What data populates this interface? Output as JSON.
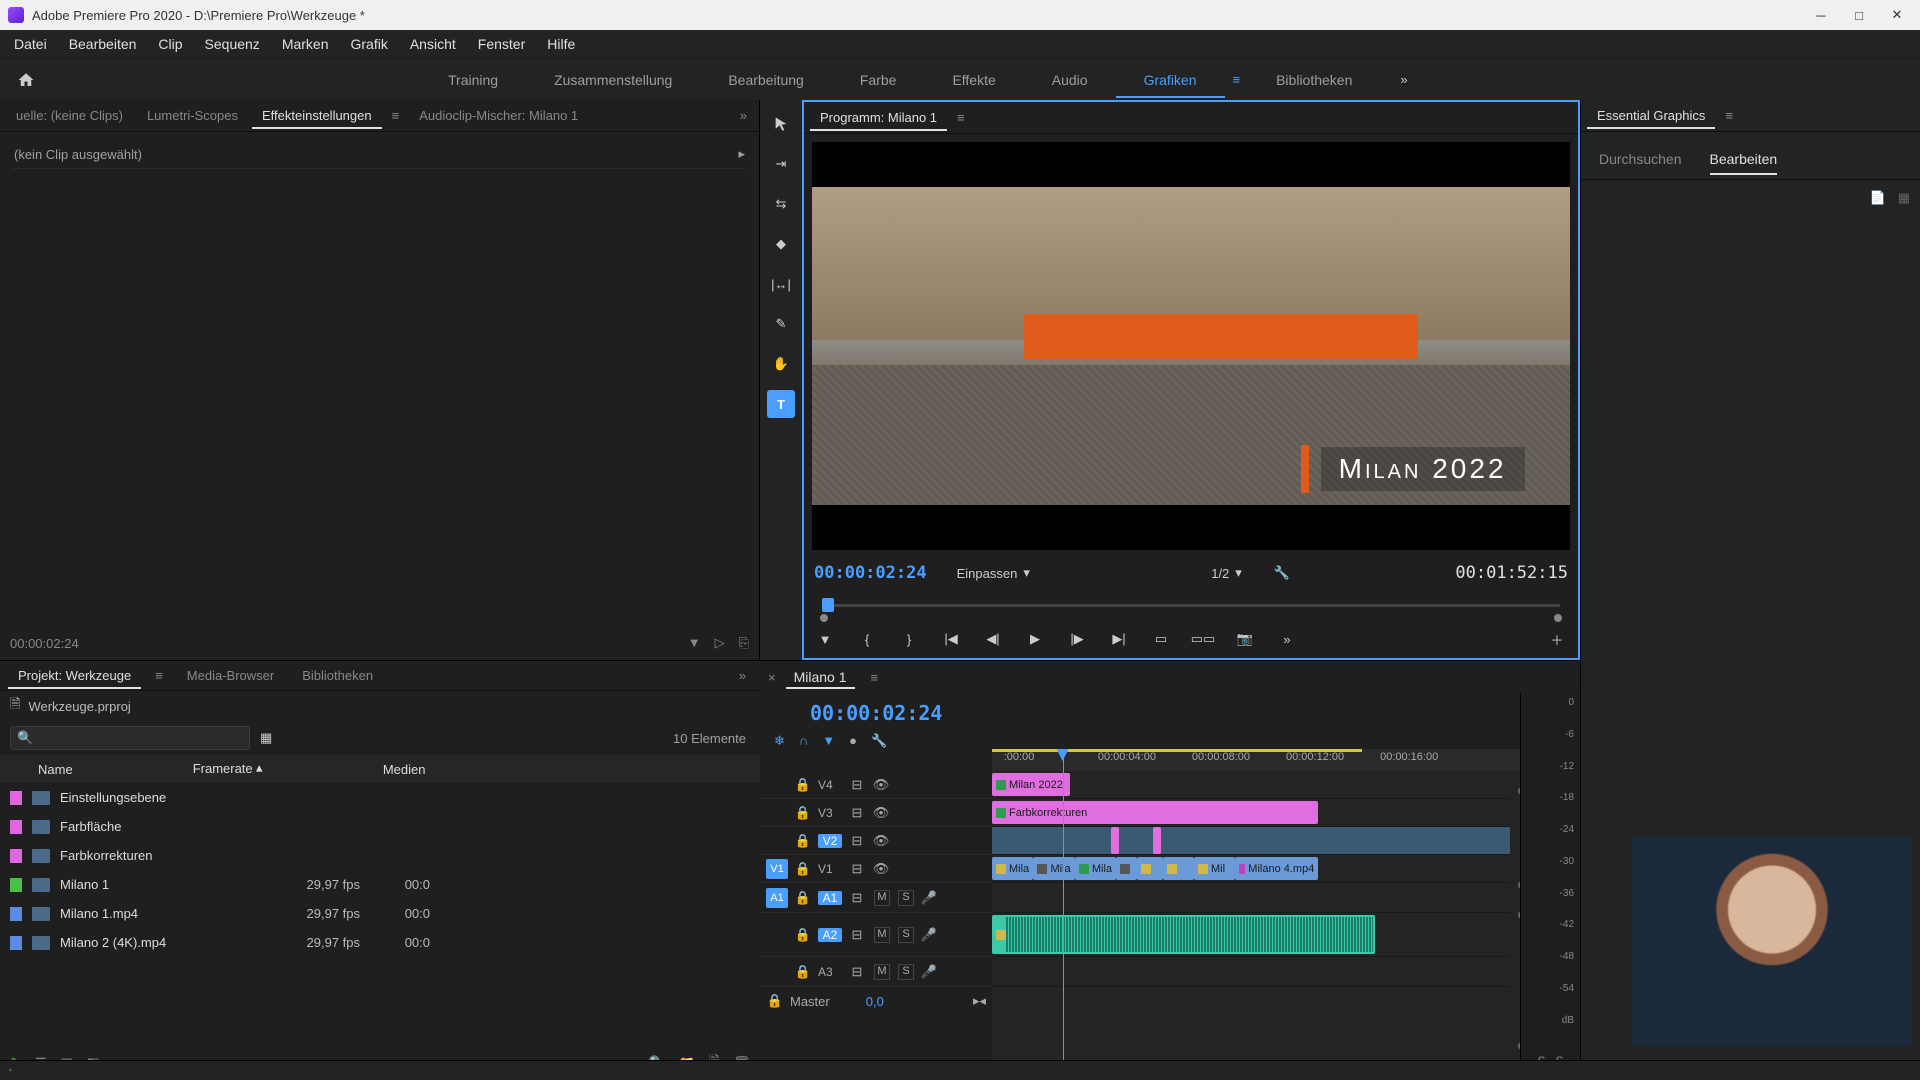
{
  "window": {
    "title": "Adobe Premiere Pro 2020 - D:\\Premiere Pro\\Werkzeuge *"
  },
  "menu": {
    "items": [
      "Datei",
      "Bearbeiten",
      "Clip",
      "Sequenz",
      "Marken",
      "Grafik",
      "Ansicht",
      "Fenster",
      "Hilfe"
    ]
  },
  "workspaces": {
    "items": [
      "Training",
      "Zusammenstellung",
      "Bearbeitung",
      "Farbe",
      "Effekte",
      "Audio",
      "Grafiken",
      "Bibliotheken"
    ],
    "active": "Grafiken"
  },
  "source_tabs": {
    "items": [
      "uelle: (keine Clips)",
      "Lumetri-Scopes",
      "Effekteinstellungen",
      "Audioclip-Mischer: Milano 1"
    ],
    "active": "Effekteinstellungen"
  },
  "effect": {
    "noclip": "(kein Clip ausgewählt)",
    "tc": "00:00:02:24"
  },
  "program": {
    "tab": "Programm: Milano 1",
    "title_overlay": "Milan 2022",
    "tc": "00:00:02:24",
    "fit": "Einpassen",
    "res": "1/2",
    "duration": "00:01:52:15"
  },
  "eg": {
    "title": "Essential Graphics",
    "tabs": [
      "Durchsuchen",
      "Bearbeiten"
    ],
    "active": "Bearbeiten"
  },
  "project": {
    "tabs": [
      "Projekt: Werkzeuge",
      "Media-Browser",
      "Bibliotheken"
    ],
    "active": "Projekt: Werkzeuge",
    "file": "Werkzeuge.prproj",
    "count": "10 Elemente",
    "cols": {
      "name": "Name",
      "framerate": "Framerate",
      "medien": "Medien"
    },
    "rows": [
      {
        "swatch": "sw-pink",
        "name": "Einstellungsebene",
        "fr": "",
        "med": ""
      },
      {
        "swatch": "sw-pink",
        "name": "Farbfläche",
        "fr": "",
        "med": ""
      },
      {
        "swatch": "sw-pink",
        "name": "Farbkorrekturen",
        "fr": "",
        "med": ""
      },
      {
        "swatch": "sw-green",
        "name": "Milano 1",
        "fr": "29,97 fps",
        "med": "00:0"
      },
      {
        "swatch": "sw-blue",
        "name": "Milano 1.mp4",
        "fr": "29,97 fps",
        "med": "00:0"
      },
      {
        "swatch": "sw-blue",
        "name": "Milano 2 (4K).mp4",
        "fr": "29,97 fps",
        "med": "00:0"
      }
    ]
  },
  "timeline": {
    "seq": "Milano 1",
    "tc": "00:00:02:24",
    "ruler": [
      ":00:00",
      "00:00:04:00",
      "00:00:08:00",
      "00:00:12:00",
      "00:00:16:00"
    ],
    "v4": "V4",
    "v3": "V3",
    "v2": "V2",
    "v1": "V1",
    "a1": "A1",
    "a2": "A2",
    "a3": "A3",
    "v1patch": "V1",
    "a1patch": "A1",
    "master": "Master",
    "master_val": "0,0",
    "clips": {
      "v4": "Milan 2022",
      "v3": "Farbkorrekturen",
      "v1": [
        "Mila",
        "Mila",
        "Mila",
        "",
        "",
        "",
        "Mil",
        "Milano 4.mp4"
      ]
    },
    "meters": [
      "0",
      "-6",
      "-12",
      "-18",
      "-24",
      "-30",
      "-36",
      "-42",
      "-48",
      "-54",
      "dB"
    ],
    "solo": "S"
  }
}
